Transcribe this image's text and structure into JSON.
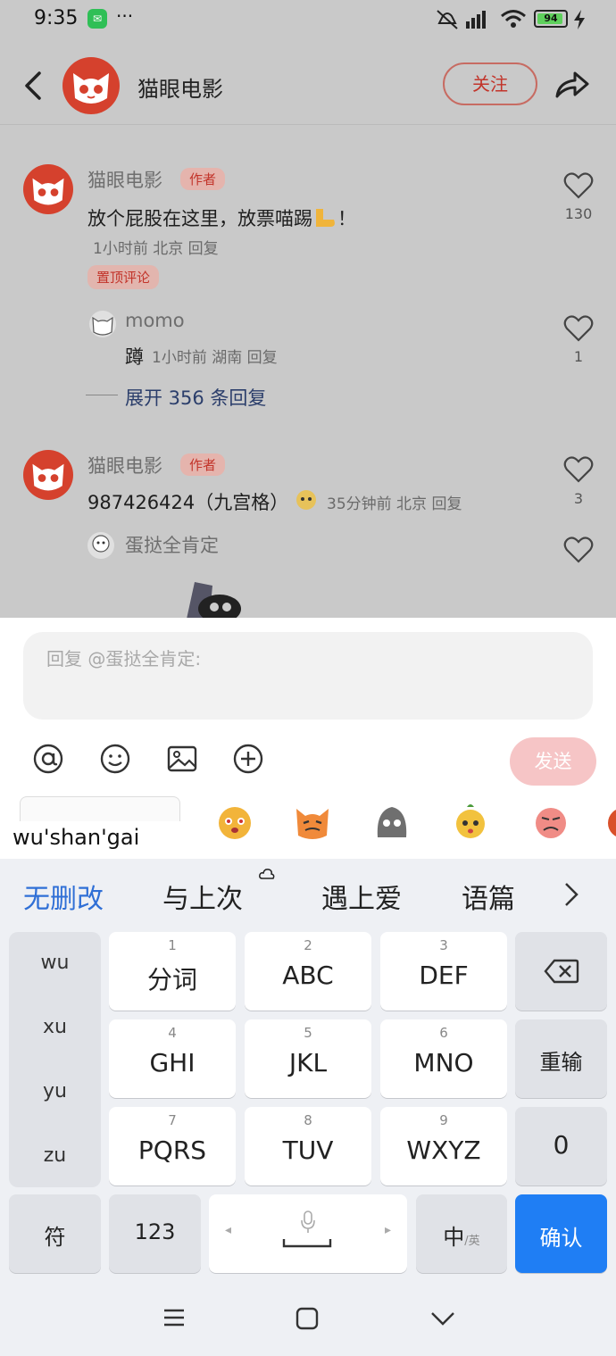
{
  "status": {
    "time": "9:35",
    "dots": "···",
    "battery": "94",
    "battery_level": 0.94
  },
  "header": {
    "title": "猫眼电影",
    "follow_label": "关注"
  },
  "comments": [
    {
      "name": "猫眼电影",
      "tag": "作者",
      "text": "放个屁股在这里，放票喵踢",
      "meta": "1小时前 北京 回复",
      "pinned": "置顶评论",
      "likes": "130"
    },
    {
      "name": "猫眼电影",
      "tag": "作者",
      "text": "987426424（九宫格）",
      "meta": "35分钟前 北京 回复",
      "likes": "3"
    }
  ],
  "replies": [
    {
      "name": "momo",
      "text": "蹲",
      "meta": "1小时前 湖南 回复",
      "likes": "1"
    },
    {
      "name": "蛋挞全肯定"
    }
  ],
  "expand": "展开 356 条回复",
  "reply_box": {
    "placeholder": "回复 @蛋挞全肯定:",
    "send_label": "发送"
  },
  "ime": {
    "composition": "wu'shan'gai",
    "candidates": [
      "无删改",
      "与上次",
      "遇上爱",
      "语篇"
    ],
    "pinyin_options": [
      "wu",
      "xu",
      "yu",
      "zu"
    ],
    "keys": [
      {
        "num": "1",
        "label": "分词"
      },
      {
        "num": "2",
        "label": "ABC"
      },
      {
        "num": "3",
        "label": "DEF"
      },
      {
        "num": "4",
        "label": "GHI"
      },
      {
        "num": "5",
        "label": "JKL"
      },
      {
        "num": "6",
        "label": "MNO"
      },
      {
        "num": "7",
        "label": "PQRS"
      },
      {
        "num": "8",
        "label": "TUV"
      },
      {
        "num": "9",
        "label": "WXYZ"
      }
    ],
    "retype": "重输",
    "zero": "0",
    "symbol": "符",
    "numeric": "123",
    "lang_main": "中",
    "lang_alt": "/英",
    "confirm": "确认"
  },
  "colors": {
    "brand_red": "#d5412d",
    "accent_blue": "#1f7ef4",
    "candidate_blue": "#2f6fd6",
    "send_pink": "#f6c5c6"
  }
}
